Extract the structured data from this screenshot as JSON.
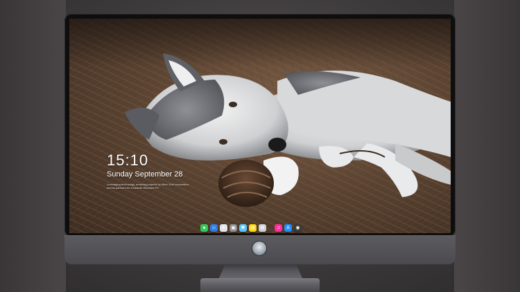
{
  "lock_screen": {
    "time": "15:10",
    "date": "Sunday September 28",
    "caption": "Leveraging technology, amazing projects by Micro Soft corporation and its partners for a smarter Windows PC"
  },
  "dock": {
    "items": [
      {
        "name": "messages-icon",
        "glyph": "●",
        "color": "#34c759"
      },
      {
        "name": "finder-icon",
        "glyph": "☺",
        "color": "#2f7de1"
      },
      {
        "name": "safari-icon",
        "glyph": "✦",
        "color": "#e5e5ea"
      },
      {
        "name": "preview-icon",
        "glyph": "▣",
        "color": "#8e8e93"
      },
      {
        "name": "imovie-icon",
        "glyph": "✱",
        "color": "#5ac8fa"
      },
      {
        "name": "notes-icon",
        "glyph": "▤",
        "color": "#ffd60a"
      },
      {
        "name": "photos-icon",
        "glyph": "✿",
        "color": "#d1d1d6"
      },
      {
        "name": "itunes-icon",
        "glyph": "♫",
        "color": "#ff2d95"
      },
      {
        "name": "app-store-icon",
        "glyph": "A",
        "color": "#1e90ff"
      },
      {
        "name": "camera-icon",
        "glyph": "◉",
        "color": "#3a3a3c"
      }
    ]
  },
  "colors": {
    "bezel": "#0e0e0f",
    "chin": "#54535a",
    "background": "#3d3a3b"
  }
}
